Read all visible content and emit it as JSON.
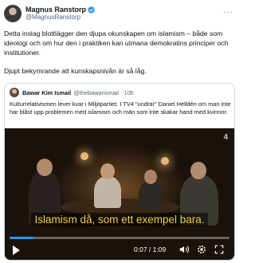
{
  "author": {
    "name": "Magnus Ranstorp",
    "handle": "@MagnusRanstorp"
  },
  "tweet": {
    "paragraph1": "Detta inslag blottlägger den djupa okunskapen om islamism – både som ideologi och om hur den i praktiken kan utmana demokratins principer och institutioner.",
    "paragraph2": "Djupt bekymrande att kunskapsnivån är så låg."
  },
  "quoted": {
    "name": "Bawar Kim Ismail",
    "handle": "@thebawarismail · 10h",
    "text": "Kulturrelativismen lever kvar i Miljöpartiet. I TV4 \"undrar\" Daniel Helldén om man inte har blåst upp problemen med islamism och män som inte skakar hand med kvinnor."
  },
  "video": {
    "channel_logo": "4",
    "caption": "Islamism då, som ett exempel bara.",
    "time": "0:07 / 1:09",
    "progress": 0.11
  },
  "icons": {
    "verified": "verified-badge-icon",
    "more": "more-options-icon",
    "play": "play-icon",
    "volume": "volume-icon",
    "settings": "gear-icon",
    "fullscreen": "fullscreen-icon"
  },
  "colors": {
    "accent": "#1d9bf0",
    "caption": "#f4d63a"
  }
}
